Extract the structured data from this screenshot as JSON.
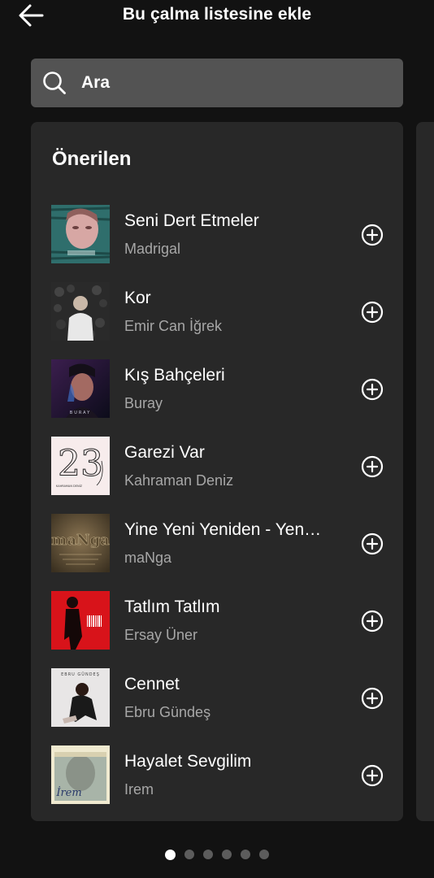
{
  "header": {
    "title": "Bu çalma listesine ekle",
    "back_icon": "arrow-left-icon"
  },
  "search": {
    "placeholder": "Ara",
    "icon": "search-icon"
  },
  "section": {
    "title": "Önerilen",
    "tracks": [
      {
        "title": "Seni Dert Etmeler",
        "artist": "Madrigal",
        "cover": "madrigal"
      },
      {
        "title": "Kor",
        "artist": "Emir Can İğrek",
        "cover": "kor"
      },
      {
        "title": "Kış Bahçeleri",
        "artist": "Buray",
        "cover": "buray"
      },
      {
        "title": "Garezi Var",
        "artist": "Kahraman Deniz",
        "cover": "garezi"
      },
      {
        "title": "Yine Yeni Yeniden - Yen…",
        "artist": "maNga",
        "cover": "manga"
      },
      {
        "title": "Tatlım Tatlım",
        "artist": "Ersay Üner",
        "cover": "ersay"
      },
      {
        "title": "Cennet",
        "artist": "Ebru Gündeş",
        "cover": "ebru"
      },
      {
        "title": "Hayalet Sevgilim",
        "artist": "Irem",
        "cover": "irem"
      }
    ]
  },
  "cover_text": {
    "buray": "BURAY",
    "garezi_number": "23",
    "garezi_artist": "KAHRAMAN DENİZ",
    "manga": "maNga",
    "ebru": "EBRU GÜNDEŞ",
    "irem": "İrem"
  },
  "pager": {
    "count": 6,
    "active": 0
  },
  "colors": {
    "background": "#121212",
    "card": "#282828",
    "search": "#535353",
    "secondary_text": "#a7a7a7"
  }
}
